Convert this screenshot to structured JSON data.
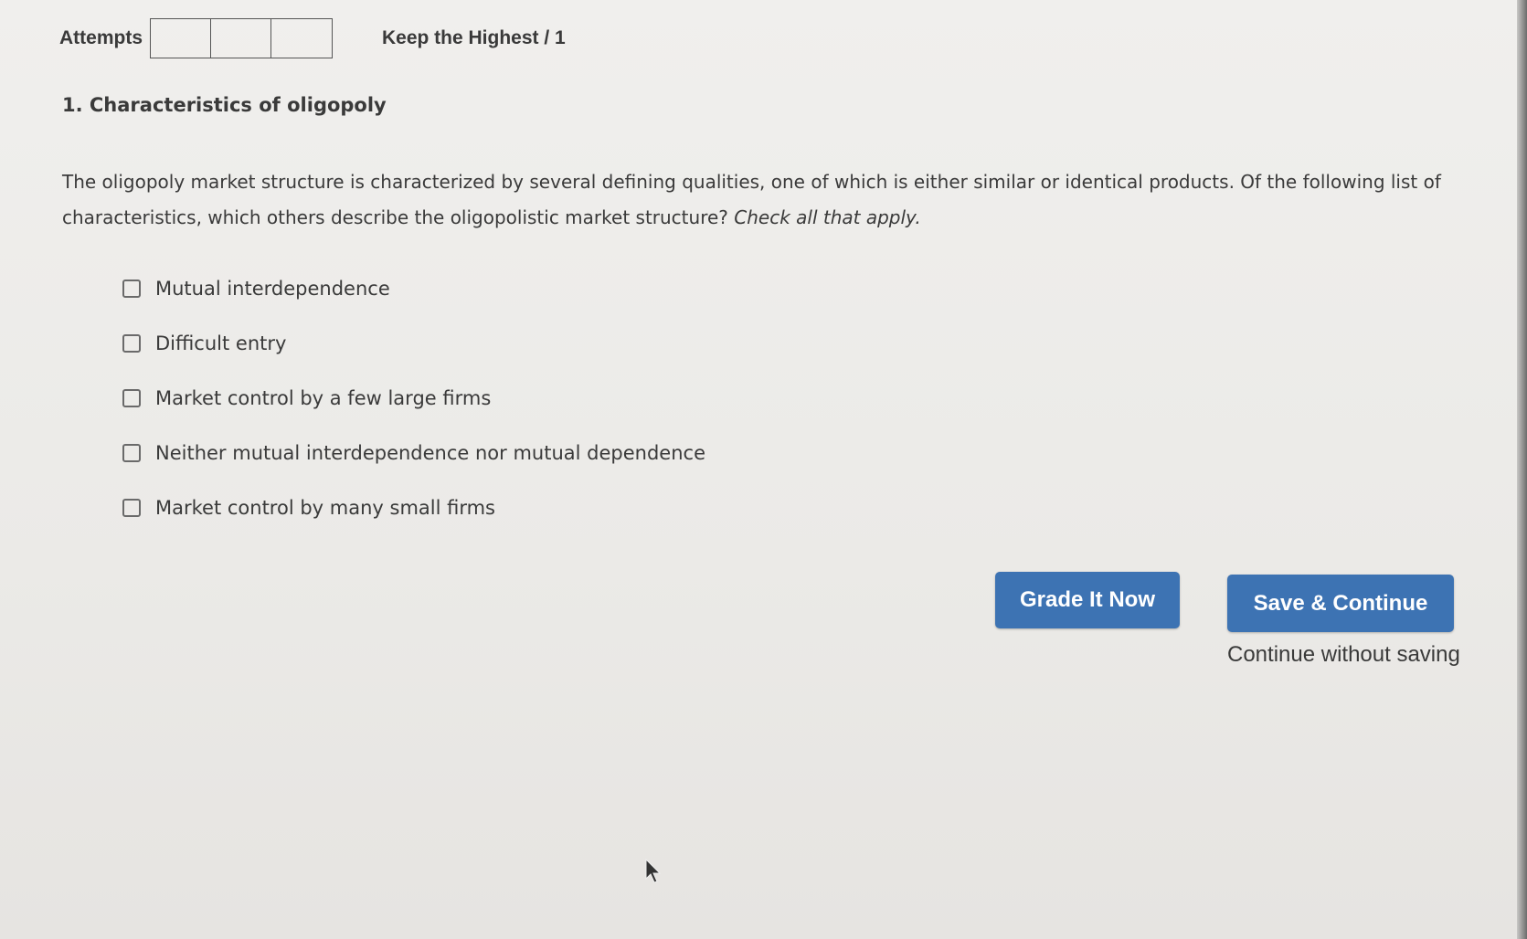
{
  "header": {
    "attempts_label": "Attempts",
    "attempt_slots": [
      "",
      "",
      ""
    ],
    "grading_label": "Keep the Highest / 1"
  },
  "question": {
    "title": "1. Characteristics of oligopoly",
    "prompt_main": "The oligopoly market structure is characterized by several defining qualities, one of which is either similar or identical products. Of the following list of characteristics, which others describe the oligopolistic market structure?",
    "prompt_instruction": "Check all that apply.",
    "options": [
      {
        "label": "Mutual interdependence",
        "checked": false
      },
      {
        "label": "Difficult entry",
        "checked": false
      },
      {
        "label": "Market control by a few large firms",
        "checked": false
      },
      {
        "label": "Neither mutual interdependence nor mutual dependence",
        "checked": false
      },
      {
        "label": "Market control by many small firms",
        "checked": false
      }
    ]
  },
  "actions": {
    "grade_label": "Grade It Now",
    "save_label": "Save & Continue",
    "continue_without_saving": "Continue without saving"
  },
  "colors": {
    "button": "#3d73b3",
    "text": "#3a3a3a",
    "background": "#ecebe9"
  },
  "icons": {
    "checkbox": "empty-square",
    "cursor": "arrow-pointer"
  }
}
